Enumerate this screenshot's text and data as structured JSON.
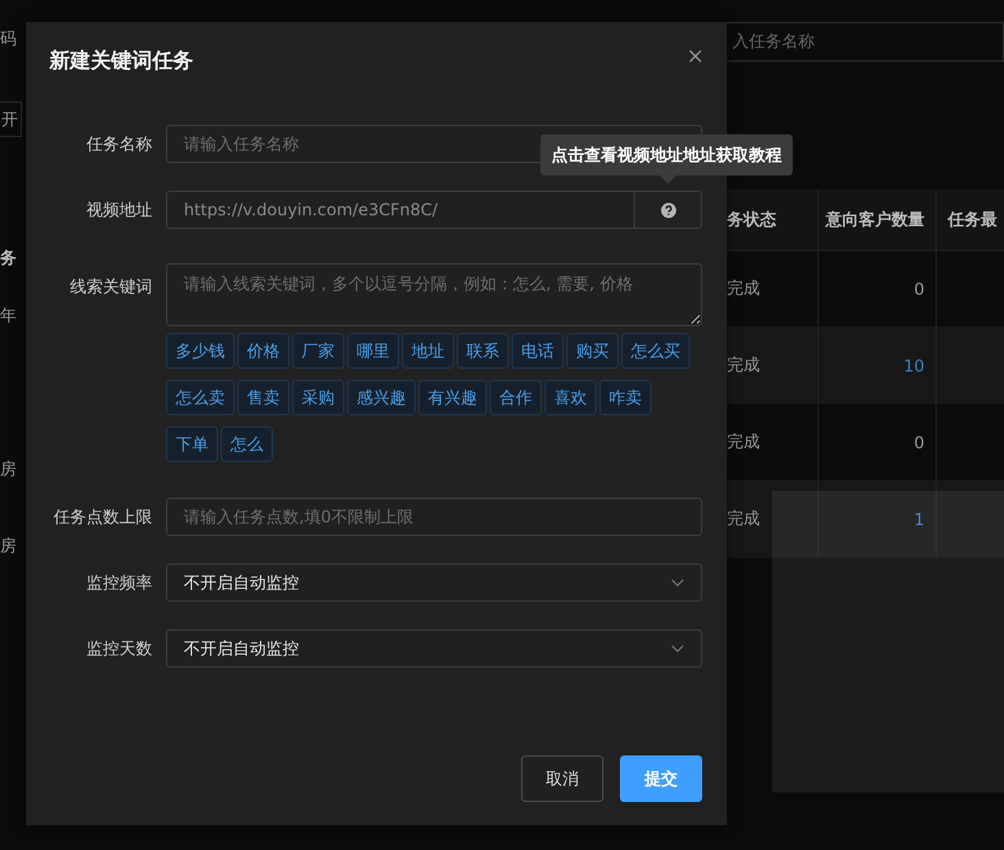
{
  "background": {
    "left_strip": [
      "码",
      "开",
      "务",
      "年",
      "房",
      "房"
    ],
    "search_field": {
      "placeholder": "入任务名称"
    },
    "table": {
      "columns": [
        "务状态",
        "意向客户数量",
        "任务最"
      ],
      "rows": [
        {
          "status": "完成",
          "count": "0",
          "link": false
        },
        {
          "status": "完成",
          "count": "10",
          "link": true
        },
        {
          "status": "完成",
          "count": "0",
          "link": false
        },
        {
          "status": "完成",
          "count": "1",
          "link": true
        }
      ]
    }
  },
  "dialog": {
    "title": "新建关键词任务",
    "fields": [
      {
        "kind": "input",
        "label": "任务名称",
        "placeholder": "请输入任务名称"
      },
      {
        "kind": "addon",
        "label": "视频地址",
        "placeholder": "https://v.douyin.com/e3CFn8C/",
        "tooltip": "点击查看视频地址地址获取教程"
      },
      {
        "kind": "textarea",
        "label": "线索关键词",
        "placeholder": "请输入线索关键词，多个以逗号分隔，例如：怎么, 需要, 价格",
        "tags": [
          "多少钱",
          "价格",
          "厂家",
          "哪里",
          "地址",
          "联系",
          "电话",
          "购买",
          "怎么买",
          "怎么卖",
          "售卖",
          "采购",
          "感兴趣",
          "有兴趣",
          "合作",
          "喜欢",
          "咋卖",
          "下单",
          "怎么"
        ]
      },
      {
        "kind": "input",
        "label": "任务点数上限",
        "placeholder": "请输入任务点数,填0不限制上限"
      },
      {
        "kind": "select",
        "label": "监控频率",
        "value": "不开启自动监控"
      },
      {
        "kind": "select",
        "label": "监控天数",
        "value": "不开启自动监控"
      }
    ],
    "buttons": [
      {
        "kind": "secondary",
        "label": "取消"
      },
      {
        "kind": "primary",
        "label": "提交"
      }
    ]
  }
}
